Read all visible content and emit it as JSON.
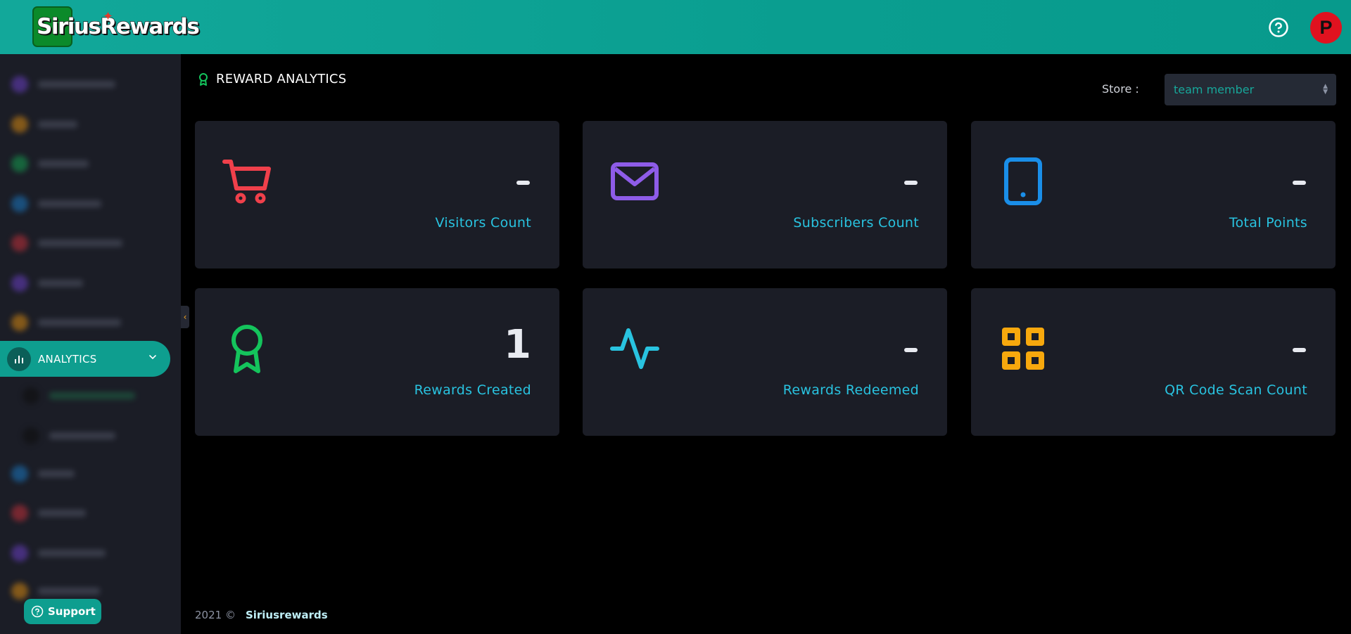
{
  "header": {
    "logo_part1": "Sirius",
    "logo_part2": "Rewards",
    "help_icon": "help-circle-icon",
    "avatar_initial": "P"
  },
  "sidebar": {
    "active_item": {
      "label": "ANALYTICS",
      "icon": "bar-chart-icon"
    },
    "collapse_icon": "chevron-left-icon",
    "support_label": "Support"
  },
  "page": {
    "title": "REWARD ANALYTICS",
    "title_icon": "award-icon",
    "store_label": "Store :",
    "store_value": "team member"
  },
  "cards": [
    {
      "label": "Visitors Count",
      "value": "-",
      "icon": "shopping-cart-icon",
      "color": "#f0404b"
    },
    {
      "label": "Subscribers Count",
      "value": "-",
      "icon": "mail-icon",
      "color": "#8e5ce8"
    },
    {
      "label": "Total Points",
      "value": "-",
      "icon": "tablet-icon",
      "color": "#1a8ee8"
    },
    {
      "label": "Rewards Created",
      "value": "1",
      "icon": "award-icon",
      "color": "#14c45c"
    },
    {
      "label": "Rewards Redeemed",
      "value": "-",
      "icon": "activity-icon",
      "color": "#29c3e0"
    },
    {
      "label": "QR Code Scan Count",
      "value": "-",
      "icon": "grid-icon",
      "color": "#f7a80d"
    }
  ],
  "footer": {
    "year": "2021 ©",
    "brand": "Siriusrewards"
  }
}
